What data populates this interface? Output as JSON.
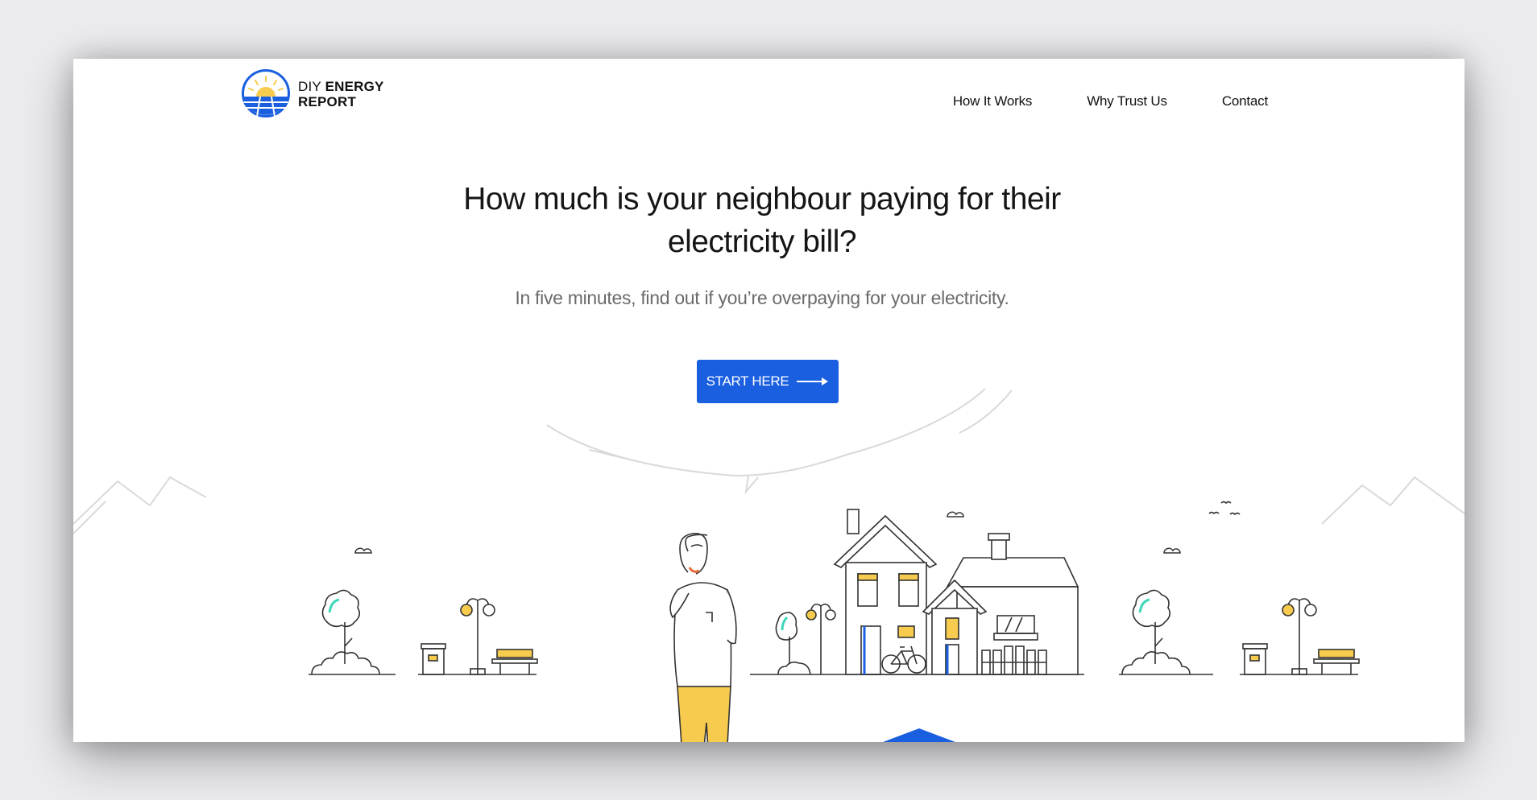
{
  "logo": {
    "line1_light": "DIY",
    "line1_bold": "ENERGY",
    "line2": "REPORT"
  },
  "nav": [
    {
      "label": "How It Works"
    },
    {
      "label": "Why Trust Us"
    },
    {
      "label": "Contact"
    }
  ],
  "hero": {
    "title": "How much is your neighbour paying for their electricity bill?",
    "subtitle": "In five minutes, find out if you’re overpaying for your electricity.",
    "cta_label": "START HERE"
  },
  "colors": {
    "accent": "#1a5fe0",
    "yellow": "#f7cb4d",
    "teal": "#3fd6b8",
    "outline": "#333333",
    "hill": "#d9d9d9"
  }
}
